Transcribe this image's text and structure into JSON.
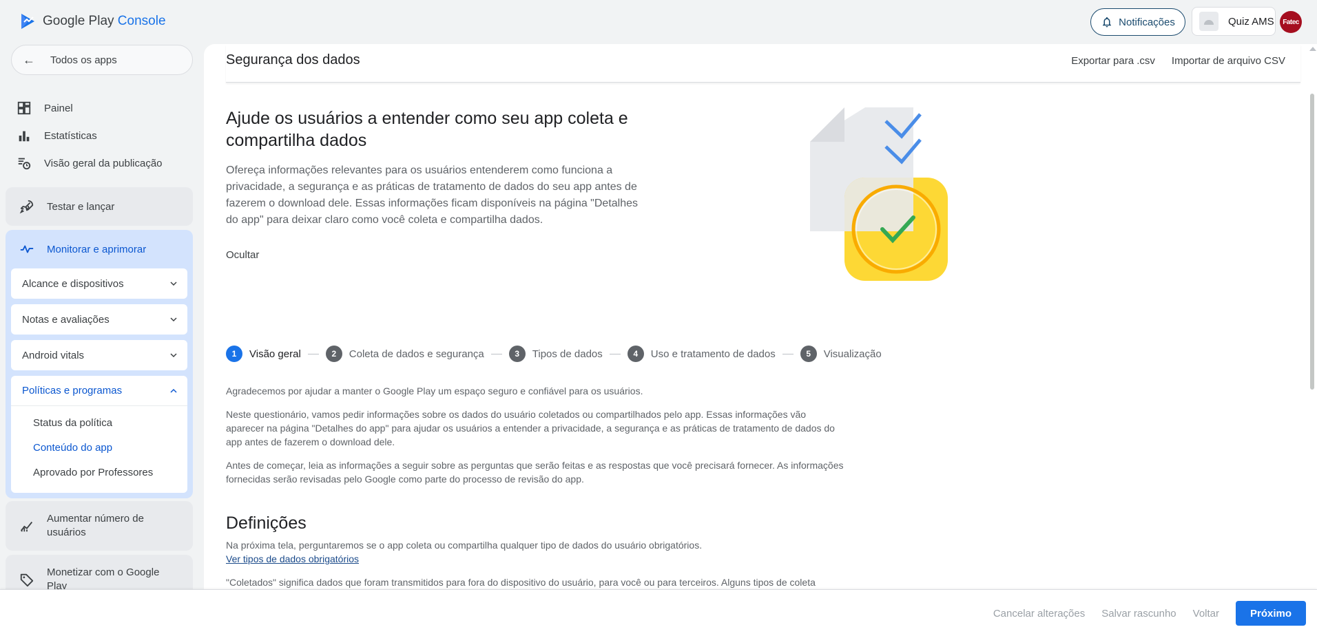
{
  "brand": {
    "google_play": "Google Play",
    "console": "Console"
  },
  "topbar": {
    "notifications_label": "Notificações",
    "app_name": "Quiz AMS",
    "avatar_text": "Fatec"
  },
  "sidebar": {
    "all_apps": "Todos os apps",
    "items": [
      {
        "label": "Painel",
        "icon": "dashboard-icon"
      },
      {
        "label": "Estatísticas",
        "icon": "bar-chart-icon"
      },
      {
        "label": "Visão geral da publicação",
        "icon": "publishing-overview-icon"
      }
    ],
    "test_release": "Testar e lançar",
    "monitor": "Monitorar e aprimorar",
    "monitor_children": [
      {
        "label": "Alcance e dispositivos"
      },
      {
        "label": "Notas e avaliações"
      },
      {
        "label": "Android vitals"
      }
    ],
    "policies": "Políticas e programas",
    "policies_children": [
      {
        "label": "Status da política"
      },
      {
        "label": "Conteúdo do app"
      },
      {
        "label": "Aprovado por Professores"
      }
    ],
    "grow": "Aumentar número de usuários",
    "monetize": "Monetizar com o Google Play"
  },
  "header": {
    "title": "Segurança dos dados",
    "export_label": "Exportar para .csv",
    "import_label": "Importar de arquivo CSV"
  },
  "hero": {
    "title": "Ajude os usuários a entender como seu app coleta e compartilha dados",
    "text": "Ofereça informações relevantes para os usuários entenderem como funciona a privacidade, a segurança e as práticas de tratamento de dados do seu app antes de fazerem o download dele. Essas informações ficam disponíveis na página \"Detalhes do app\" para deixar claro como você coleta e compartilha dados.",
    "hide_label": "Ocultar"
  },
  "steps": [
    {
      "num": "1",
      "label": "Visão geral"
    },
    {
      "num": "2",
      "label": "Coleta de dados e segurança"
    },
    {
      "num": "3",
      "label": "Tipos de dados"
    },
    {
      "num": "4",
      "label": "Uso e tratamento de dados"
    },
    {
      "num": "5",
      "label": "Visualização"
    }
  ],
  "content": {
    "p1": "Agradecemos por ajudar a manter o Google Play um espaço seguro e confiável para os usuários.",
    "p2": "Neste questionário, vamos pedir informações sobre os dados do usuário coletados ou compartilhados pelo app. Essas informações vão aparecer na página \"Detalhes do app\" para ajudar os usuários a entender a privacidade, a segurança e as práticas de tratamento de dados do app antes de fazerem o download dele.",
    "p3": "Antes de começar, leia as informações a seguir sobre as perguntas que serão feitas e as respostas que você precisará fornecer. As informações fornecidas serão revisadas pelo Google como parte do processo de revisão do app.",
    "definitions_title": "Definições",
    "p4": "Na próxima tela, perguntaremos se o app coleta ou compartilha qualquer tipo de dados do usuário obrigatórios.",
    "required_types_link": "Ver tipos de dados obrigatórios",
    "p5": "\"Coletados\" significa dados que foram transmitidos para fora do dispositivo do usuário, para você ou para terceiros. Alguns tipos de coleta"
  },
  "footer": {
    "cancel": "Cancelar alterações",
    "save_draft": "Salvar rascunho",
    "back": "Voltar",
    "next": "Próximo"
  },
  "colors": {
    "accent": "#1a73e8",
    "active_nav_bg": "#d3e3fd",
    "avatar": "#a50e1f"
  }
}
